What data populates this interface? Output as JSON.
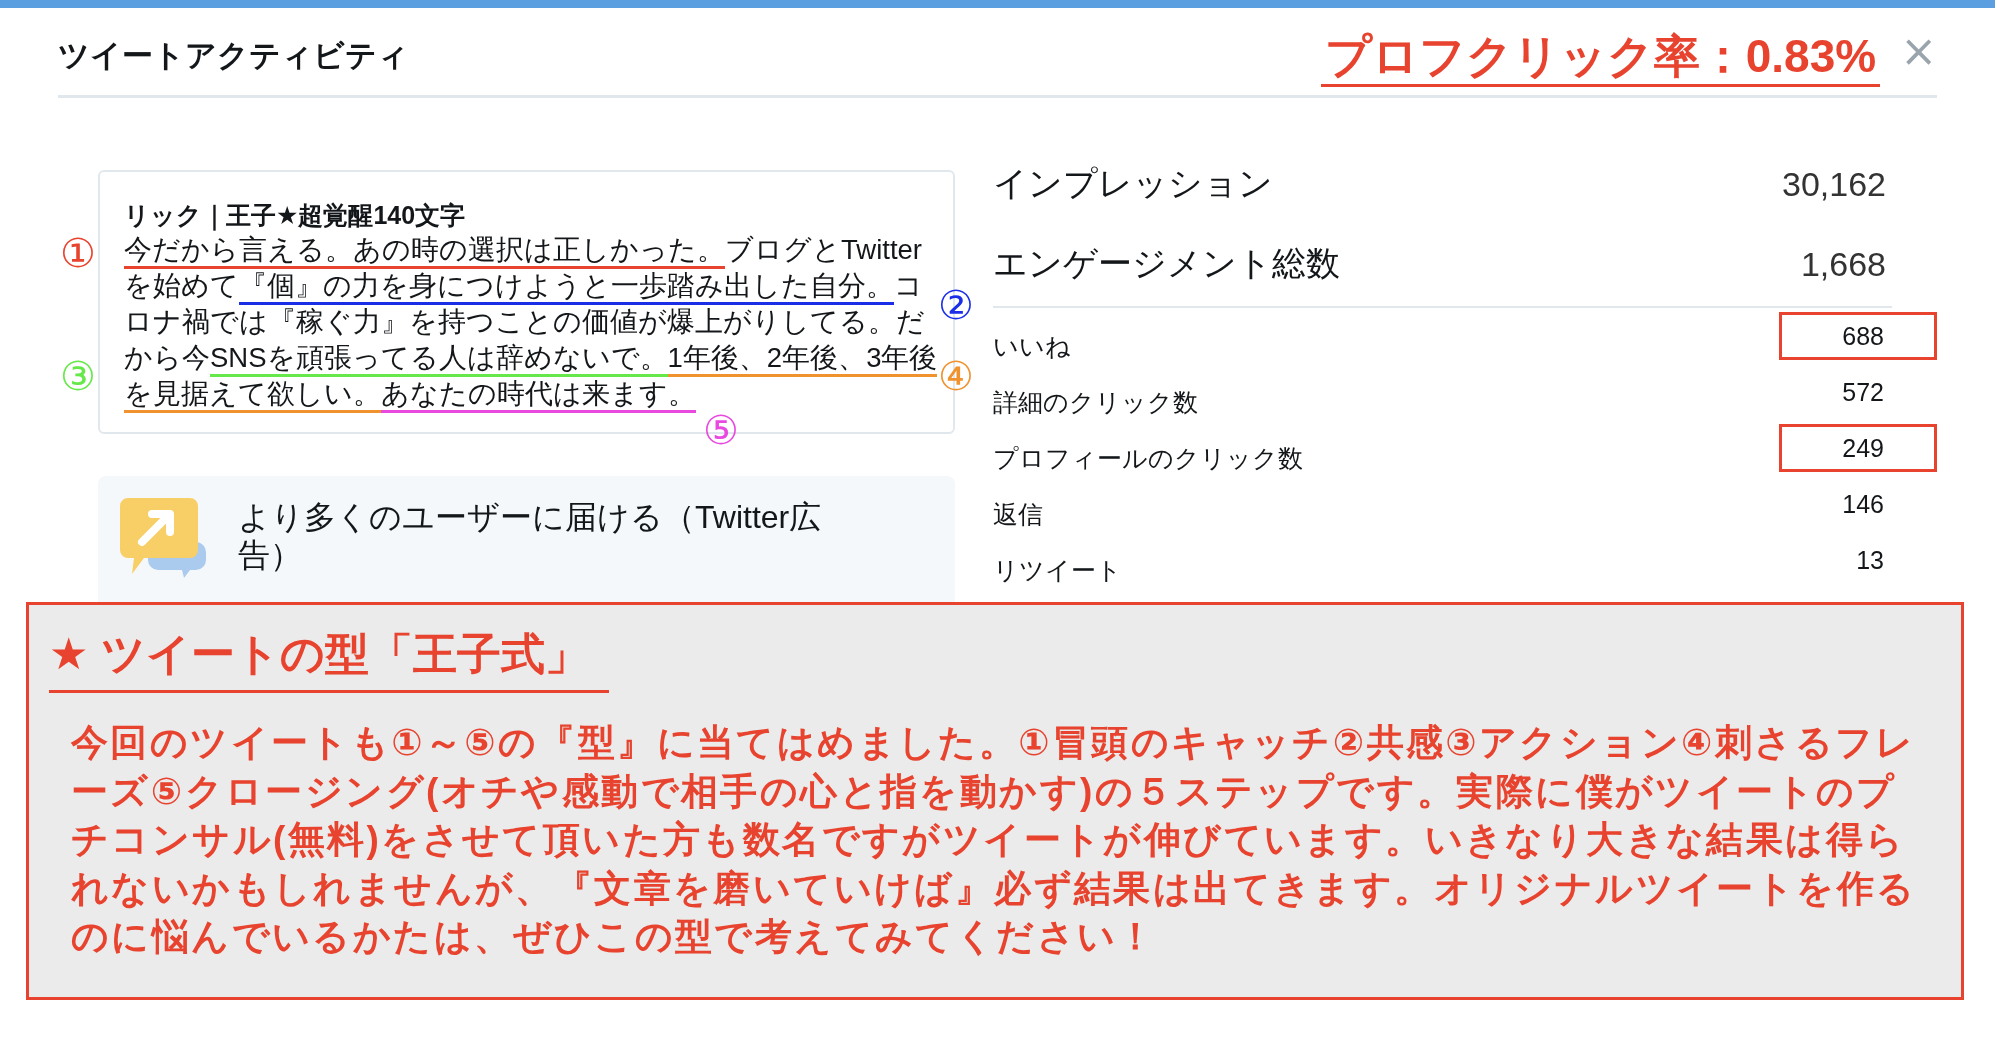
{
  "header": {
    "title": "ツイートアクティビティ",
    "profile_click_rate": "プロフクリック率：0.83%",
    "close": "×"
  },
  "tweet": {
    "author": "リック｜王子★超覚醒140文字",
    "segments": [
      {
        "text": "今だから言える。あの時の選択は正しかった。",
        "color": "#e8432e"
      },
      {
        "text": "ブログとTwitterを始めて"
      },
      {
        "text": "『個』の力を身につけようと一歩踏み出した自分。",
        "color": "#1a2ee8"
      },
      {
        "text": "コロナ禍では『稼ぐ力』を持つことの価値が爆上がりしてる。だから今"
      },
      {
        "text": "SNSを頑張ってる人は辞めないで。",
        "color": "#66e84a"
      },
      {
        "text": "1年後、2年後、3年後を見据えて欲しい。",
        "color": "#f0922e"
      },
      {
        "text": "あなたの時代は来ます。",
        "color": "#e84ae0"
      }
    ],
    "markers": [
      {
        "label": "①",
        "color": "#e8432e"
      },
      {
        "label": "②",
        "color": "#1a2ee8"
      },
      {
        "label": "③",
        "color": "#66e84a"
      },
      {
        "label": "④",
        "color": "#f0922e"
      },
      {
        "label": "⑤",
        "color": "#e84ae0"
      }
    ]
  },
  "promo": {
    "title": "より多くのユーザーに届ける（Twitter広告）"
  },
  "summary": [
    {
      "label": "インプレッション",
      "value": "30,162"
    },
    {
      "label": "エンゲージメント総数",
      "value": "1,668"
    }
  ],
  "metrics": [
    {
      "label": "いいね",
      "value": "688",
      "highlighted": true
    },
    {
      "label": "詳細のクリック数",
      "value": "572",
      "highlighted": false
    },
    {
      "label": "プロフィールのクリック数",
      "value": "249",
      "highlighted": true
    },
    {
      "label": "返信",
      "value": "146",
      "highlighted": false
    },
    {
      "label": "リツイート",
      "value": "13",
      "highlighted": false
    }
  ],
  "note": {
    "heading": "★ ツイートの型「王子式」",
    "body": "今回のツイートも①～⑤の『型』に当てはめました。①冒頭のキャッチ②共感③アクション④刺さるフレーズ⑤クロージング(オチや感動で相手の心と指を動かす)の５ステップです。実際に僕がツイートのプチコンサル(無料)をさせて頂いた方も数名ですがツイートが伸びています。いきなり大きな結果は得られないかもしれませんが、『文章を磨いていけば』必ず結果は出てきます。オリジナルツイートを作るのに悩んでいるかたは、ぜひこの型で考えてみてください！"
  }
}
